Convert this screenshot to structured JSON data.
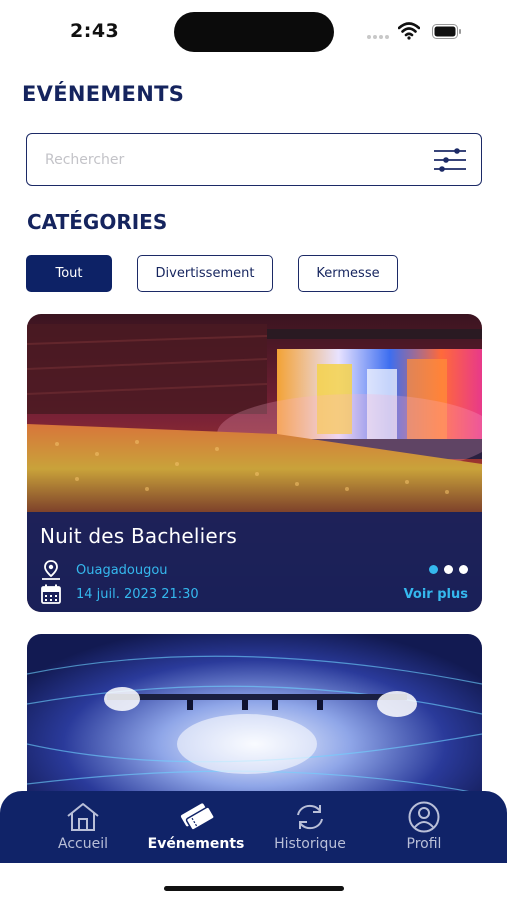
{
  "status_bar": {
    "time": "2:43"
  },
  "header": {
    "title": "EVÉNEMENTS"
  },
  "search": {
    "placeholder": "Rechercher",
    "value": ""
  },
  "categories": {
    "title": "CATÉGORIES",
    "items": [
      {
        "label": "Tout",
        "active": true
      },
      {
        "label": "Divertissement",
        "active": false
      },
      {
        "label": "Kermesse",
        "active": false
      }
    ]
  },
  "events": [
    {
      "title": "Nuit des  Bacheliers",
      "location": "Ouagadougou",
      "datetime": "14 juil. 2023 21:30",
      "cta": "Voir plus",
      "carousel_pages": 3,
      "carousel_active_index": 0
    }
  ],
  "tab_bar": {
    "items": [
      {
        "label": "Accueil",
        "icon": "home-icon",
        "active": false
      },
      {
        "label": "Evénements",
        "icon": "tickets-icon",
        "active": true
      },
      {
        "label": "Historique",
        "icon": "refresh-icon",
        "active": false
      },
      {
        "label": "Profil",
        "icon": "user-icon",
        "active": false
      }
    ]
  },
  "colors": {
    "primary": "#102368",
    "accent": "#35b8ee",
    "text": "#15245e"
  }
}
